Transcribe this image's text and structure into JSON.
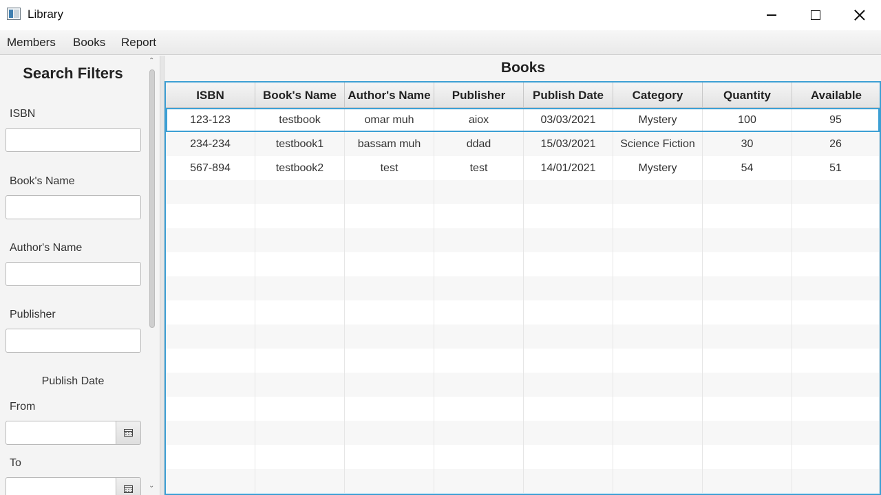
{
  "window": {
    "title": "Library",
    "icon": "app-window-icon"
  },
  "menu": {
    "items": [
      "Members",
      "Books",
      "Report"
    ]
  },
  "filters": {
    "title": "Search Filters",
    "isbn_label": "ISBN",
    "isbn_value": "",
    "book_name_label": "Book's Name",
    "book_name_value": "",
    "author_label": "Author's Name",
    "author_value": "",
    "publisher_label": "Publisher",
    "publisher_value": "",
    "publish_date_label": "Publish Date",
    "from_label": "From",
    "from_value": "",
    "to_label": "To",
    "to_value": ""
  },
  "books": {
    "title": "Books",
    "columns": [
      "ISBN",
      "Book's Name",
      "Author's Name",
      "Publisher",
      "Publish Date",
      "Category",
      "Quantity",
      "Available"
    ],
    "rows": [
      [
        "123-123",
        "testbook",
        "omar muh",
        "aiox",
        "03/03/2021",
        "Mystery",
        "100",
        "95"
      ],
      [
        "234-234",
        "testbook1",
        "bassam muh",
        "ddad",
        "15/03/2021",
        "Science Fiction",
        "30",
        "26"
      ],
      [
        "567-894",
        "testbook2",
        "test",
        "test",
        "14/01/2021",
        "Mystery",
        "54",
        "51"
      ]
    ],
    "selected_row": 0,
    "empty_rows": 13
  },
  "colors": {
    "accent": "#3c9fd4"
  }
}
